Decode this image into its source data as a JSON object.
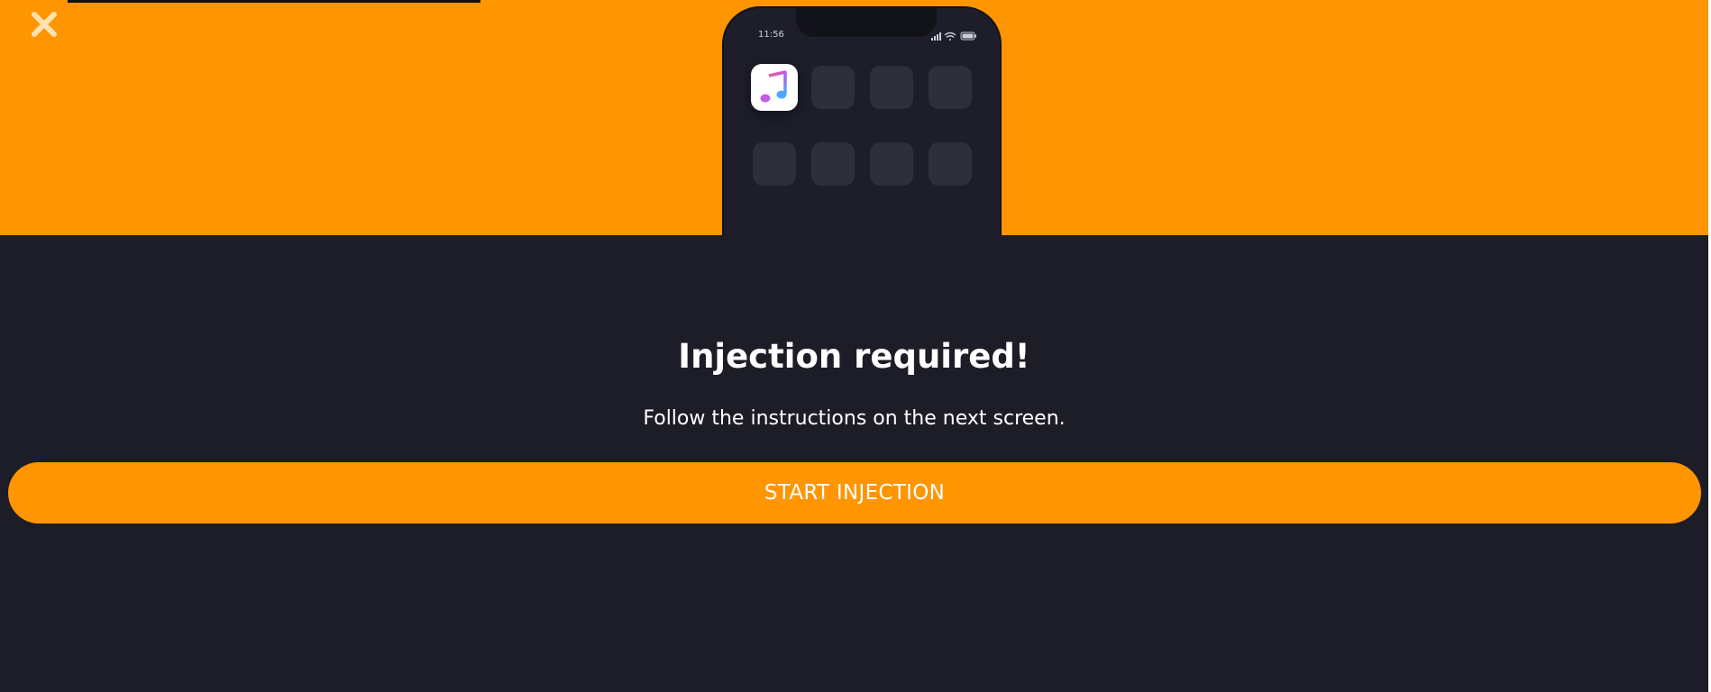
{
  "colors": {
    "accent": "#ff9500",
    "background": "#1d1d28",
    "phone_body": "#1e1e2b",
    "app_placeholder": "#2f2f3b",
    "text": "#ffffff"
  },
  "header": {
    "close_icon": "close-icon"
  },
  "phone": {
    "status_time": "11:56",
    "status_icons": [
      "signal-icon",
      "wifi-icon",
      "battery-icon"
    ],
    "apps": [
      {
        "name": "music-app-icon"
      },
      {
        "name": "app-placeholder"
      },
      {
        "name": "app-placeholder"
      },
      {
        "name": "app-placeholder"
      },
      {
        "name": "app-placeholder"
      },
      {
        "name": "app-placeholder"
      },
      {
        "name": "app-placeholder"
      },
      {
        "name": "app-placeholder"
      }
    ]
  },
  "main": {
    "title": "Injection required!",
    "subtitle": "Follow the instructions on the next screen.",
    "start_button_label": "START INJECTION"
  }
}
